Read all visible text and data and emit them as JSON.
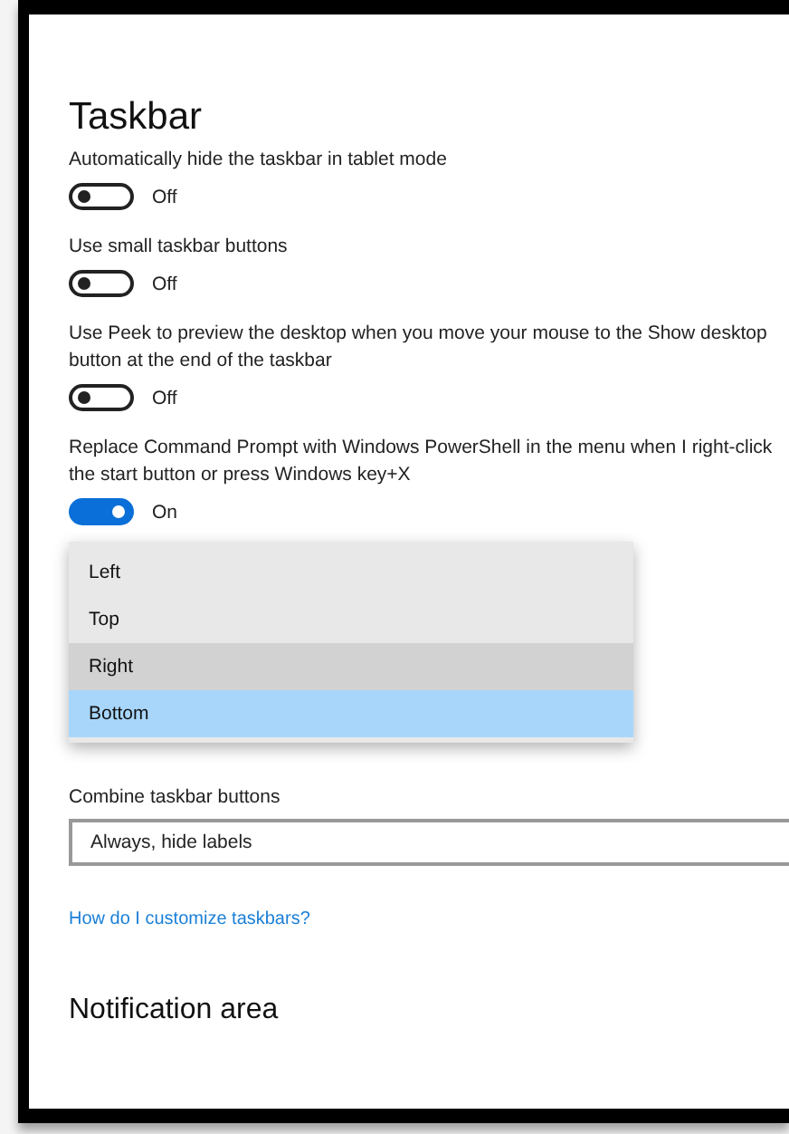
{
  "title": "Taskbar",
  "settings": [
    {
      "label": "Automatically hide the taskbar in tablet mode",
      "on": false,
      "state": "Off"
    },
    {
      "label": "Use small taskbar buttons",
      "on": false,
      "state": "Off"
    },
    {
      "label": "Use Peek to preview the desktop when you move your mouse to the Show desktop button at the end of the taskbar",
      "on": false,
      "state": "Off"
    },
    {
      "label": "Replace Command Prompt with Windows PowerShell in the menu when I right-click the start button or press Windows key+X",
      "on": true,
      "state": "On"
    }
  ],
  "dropdown_options": [
    {
      "label": "Left",
      "selected": false,
      "hovered": false
    },
    {
      "label": "Top",
      "selected": false,
      "hovered": false
    },
    {
      "label": "Right",
      "selected": false,
      "hovered": true
    },
    {
      "label": "Bottom",
      "selected": true,
      "hovered": false
    }
  ],
  "combine": {
    "label": "Combine taskbar buttons",
    "value": "Always, hide labels"
  },
  "link": "How do I customize taskbars?",
  "section": "Notification area"
}
